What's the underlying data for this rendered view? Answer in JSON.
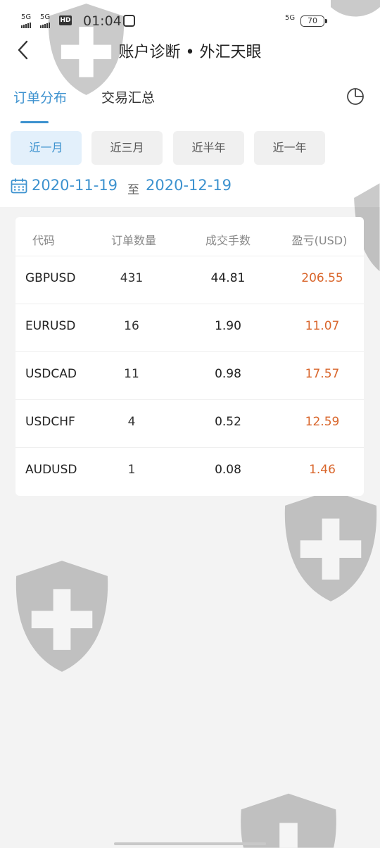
{
  "status_bar": {
    "sim1": "5G",
    "sim2": "5G",
    "hd": "HD",
    "time": "01:04",
    "network": "5G",
    "battery": "70"
  },
  "header": {
    "title": "账户诊断 • 外汇天眼",
    "back_icon": "back-arrow-icon"
  },
  "tabs": [
    {
      "label": "订单分布",
      "active": true
    },
    {
      "label": "交易汇总",
      "active": false
    }
  ],
  "chart_icon": "pie-chart-icon",
  "periods": [
    {
      "label": "近一月",
      "active": true
    },
    {
      "label": "近三月",
      "active": false
    },
    {
      "label": "近半年",
      "active": false
    },
    {
      "label": "近一年",
      "active": false
    }
  ],
  "date_range": {
    "start": "2020-11-19",
    "separator": "至",
    "end": "2020-12-19"
  },
  "table": {
    "headers": [
      "代码",
      "订单数量",
      "成交手数",
      "盈亏(USD)"
    ],
    "rows": [
      {
        "code": "GBPUSD",
        "orders": "431",
        "lots": "44.81",
        "pnl": "206.55"
      },
      {
        "code": "EURUSD",
        "orders": "16",
        "lots": "1.90",
        "pnl": "11.07"
      },
      {
        "code": "USDCAD",
        "orders": "11",
        "lots": "0.98",
        "pnl": "17.57"
      },
      {
        "code": "USDCHF",
        "orders": "4",
        "lots": "0.52",
        "pnl": "12.59"
      },
      {
        "code": "AUDUSD",
        "orders": "1",
        "lots": "0.08",
        "pnl": "1.46"
      }
    ]
  },
  "colors": {
    "accent": "#3d92cf",
    "profit": "#d9662c",
    "active_button_bg": "#e3f0fb"
  }
}
